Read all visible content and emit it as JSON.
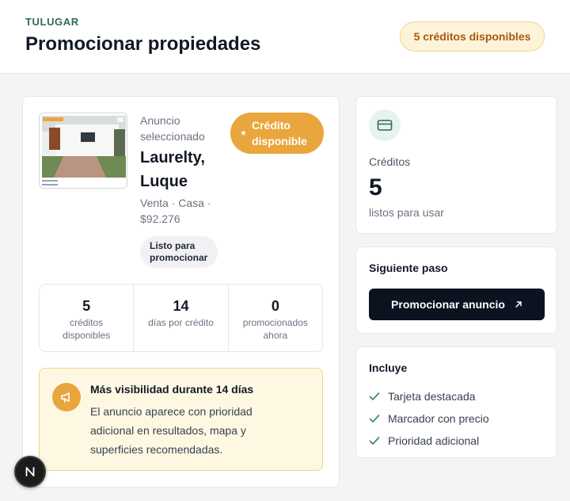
{
  "header": {
    "brand": "TULUGAR",
    "title": "Promocionar propiedades",
    "credits_pill": "5 créditos disponibles"
  },
  "listing": {
    "eyebrow": "Anuncio seleccionado",
    "name": "Laurelty, Luque",
    "meta": "Venta · Casa · $92.276",
    "status_chip": "Listo para promocionar",
    "credit_badge": "Crédito disponible"
  },
  "stats": [
    {
      "value": "5",
      "label": "créditos disponibles"
    },
    {
      "value": "14",
      "label": "días por crédito"
    },
    {
      "value": "0",
      "label": "promocionados ahora"
    }
  ],
  "info": {
    "title": "Más visibilidad durante 14 días",
    "text": "El anuncio aparece con prioridad adicional en resultados, mapa y superficies recomendadas."
  },
  "credits_card": {
    "label": "Créditos",
    "value": "5",
    "sub": "listos para usar"
  },
  "next_step": {
    "heading": "Siguiente paso",
    "button": "Promocionar anuncio"
  },
  "includes": {
    "heading": "Incluye",
    "items": [
      "Tarjeta destacada",
      "Marcador con precio",
      "Prioridad adicional"
    ]
  },
  "icons": {
    "credit_card": "credit-card-icon",
    "megaphone": "megaphone-icon",
    "check": "check-icon",
    "arrow": "arrow-up-right-icon",
    "star": "star-icon"
  },
  "colors": {
    "brand_green": "#2f6b57",
    "accent_orange": "#e9a63c",
    "pill_bg": "#fdf3d8",
    "button_dark": "#0b1220",
    "check_green": "#3f8f6b"
  }
}
